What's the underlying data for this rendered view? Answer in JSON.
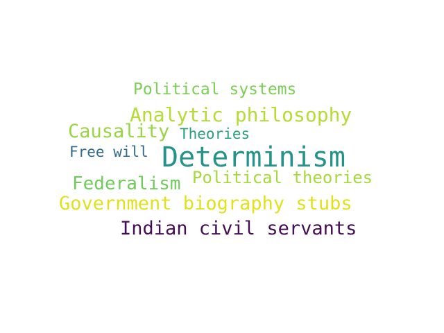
{
  "words": [
    {
      "text": "Political systems",
      "color": "#7ccf55"
    },
    {
      "text": "Analytic philosophy",
      "color": "#b5dc36"
    },
    {
      "text": "Causality",
      "color": "#98d544"
    },
    {
      "text": "Theories",
      "color": "#2aa079"
    },
    {
      "text": "Free will",
      "color": "#336a8c"
    },
    {
      "text": "Determinism",
      "color": "#26938a"
    },
    {
      "text": "Federalism",
      "color": "#6fcb5b"
    },
    {
      "text": "Political theories",
      "color": "#a5d93c"
    },
    {
      "text": "Government biography stubs",
      "color": "#e0e21c"
    },
    {
      "text": "Indian civil servants",
      "color": "#440d54"
    }
  ]
}
